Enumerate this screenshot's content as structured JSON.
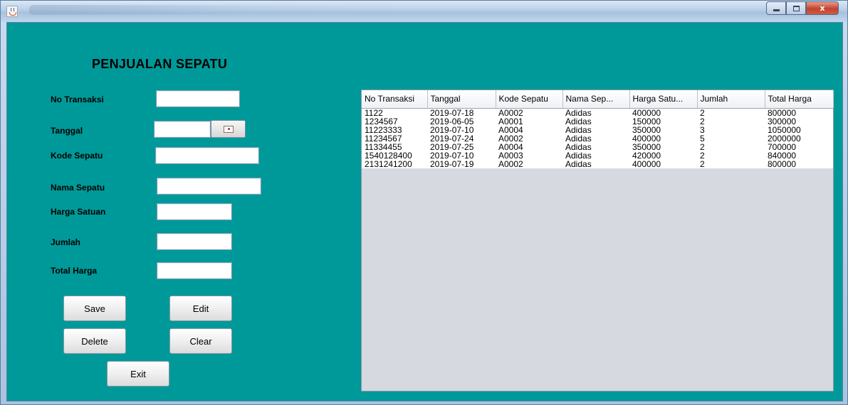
{
  "window": {
    "title": "",
    "controls": {
      "minimize": "",
      "maximize": "",
      "close": "x"
    }
  },
  "form": {
    "title": "PENJUALAN SEPATU",
    "labels": {
      "no_transaksi": "No Transaksi",
      "tanggal": "Tanggal",
      "kode_sepatu": "Kode Sepatu",
      "nama_sepatu": "Nama Sepatu",
      "harga_satuan": "Harga Satuan",
      "jumlah": "Jumlah",
      "total_harga": "Total Harga"
    },
    "values": {
      "no_transaksi": "",
      "tanggal": "",
      "kode_sepatu": "",
      "nama_sepatu": "",
      "harga_satuan": "",
      "jumlah": "",
      "total_harga": ""
    }
  },
  "buttons": {
    "save": "Save",
    "edit": "Edit",
    "delete": "Delete",
    "clear": "Clear",
    "exit": "Exit"
  },
  "table": {
    "columns": [
      "No Transaksi",
      "Tanggal",
      "Kode Sepatu",
      "Nama Sep...",
      "Harga Satu...",
      "Jumlah",
      "Total Harga"
    ],
    "rows": [
      [
        "1122",
        "2019-07-18",
        "A0002",
        "Adidas",
        "400000",
        "2",
        "800000"
      ],
      [
        "1234567",
        "2019-06-05",
        "A0001",
        "Adidas",
        "150000",
        "2",
        "300000"
      ],
      [
        "11223333",
        "2019-07-10",
        "A0004",
        "Adidas",
        "350000",
        "3",
        "1050000"
      ],
      [
        "11234567",
        "2019-07-24",
        "A0002",
        "Adidas",
        "400000",
        "5",
        "2000000"
      ],
      [
        "11334455",
        "2019-07-25",
        "A0004",
        "Adidas",
        "350000",
        "2",
        "700000"
      ],
      [
        "1540128400",
        "2019-07-10",
        "A0003",
        "Adidas",
        "420000",
        "2",
        "840000"
      ],
      [
        "2131241200",
        "2019-07-19",
        "A0002",
        "Adidas",
        "400000",
        "2",
        "800000"
      ]
    ]
  },
  "colors": {
    "panel_bg": "#009999",
    "table_bg": "#d6d9df"
  }
}
